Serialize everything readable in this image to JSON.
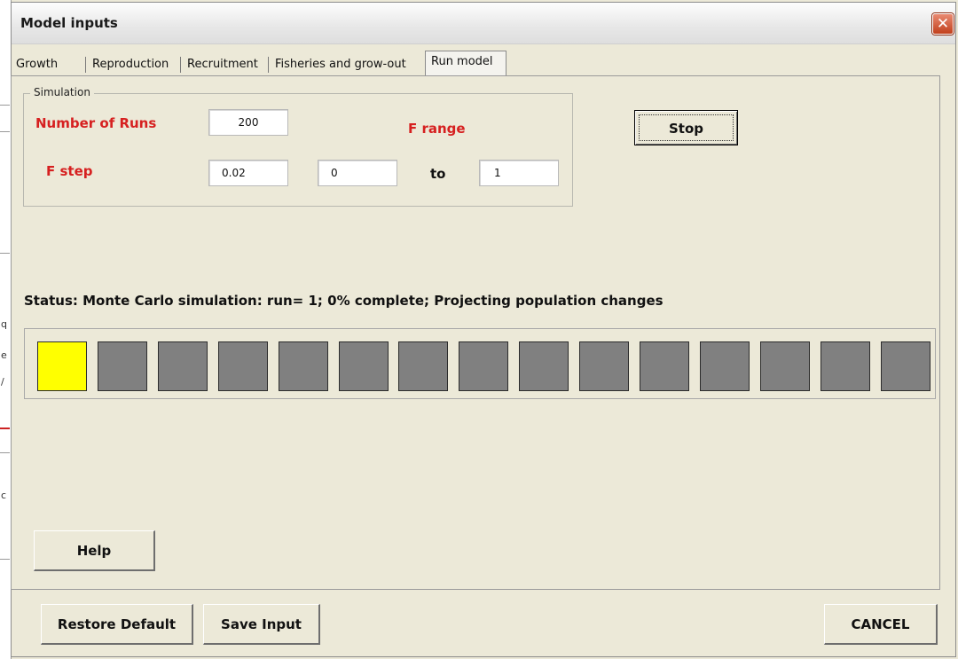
{
  "window": {
    "title": "Model inputs",
    "close_glyph": "✕"
  },
  "tabs": [
    {
      "label": "Growth",
      "active": false
    },
    {
      "label": "Reproduction",
      "active": false
    },
    {
      "label": "Recruitment",
      "active": false
    },
    {
      "label": "Fisheries and grow-out",
      "active": false
    },
    {
      "label": "Run model",
      "active": true
    }
  ],
  "simulation": {
    "group_label": "Simulation",
    "runs_label": "Number of Runs",
    "runs_value": "200",
    "fstep_label": "F step",
    "fstep_value": "0.02",
    "frange_label": "F range",
    "frange_from": "0",
    "to_label": "to",
    "frange_to": "1"
  },
  "buttons": {
    "stop": "Stop",
    "help": "Help",
    "restore_default": "Restore Default",
    "save_input": "Save Input",
    "cancel": "CANCEL"
  },
  "status_text": "Status: Monte Carlo simulation: run= 1; 0% complete; Projecting population changes",
  "progress": {
    "total_blocks": 15,
    "filled_blocks": 1,
    "filled_color": "#ffff00",
    "empty_color": "#808080"
  }
}
